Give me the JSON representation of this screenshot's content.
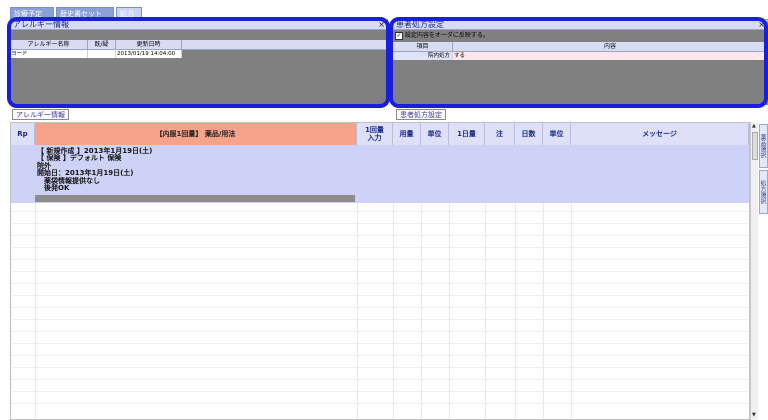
{
  "tabs": [
    {
      "label": "診療予定"
    },
    {
      "label": "歴史書セット"
    },
    {
      "label": "処方"
    }
  ],
  "allergy_panel": {
    "title": "アレルギー情報",
    "close": "×",
    "columns": [
      "アレルギー名称",
      "既/疑",
      "更新日時"
    ],
    "rows": [
      {
        "name": "ヨード",
        "type": "",
        "updated": "2013/01/19 14:04:00"
      }
    ],
    "sub_button": "アレルギー情報"
  },
  "prescription_panel": {
    "title": "患者処方設定",
    "close": "×",
    "checkbox_label": "設定内容をオーダに反映する。",
    "columns": [
      "項目",
      "内容"
    ],
    "rows": [
      {
        "item": "院内処方",
        "value": "する"
      }
    ],
    "sub_button": "患者処方設定"
  },
  "grid": {
    "headers": {
      "rp": "Rp",
      "drug": "【内服1回量】 薬品/用法",
      "dose_input": "1回量\n入力",
      "amount": "用量",
      "unit": "単位",
      "daily": "1日量",
      "note": "注",
      "days": "日数",
      "unit2": "単位",
      "message": "メッセージ"
    },
    "entry_lines": [
      "【 新規作成 】2013年1月19日(土)",
      "【 保険 】デフォルト 保険",
      "院外",
      "開始日：2013年1月19日(土)",
      "薬袋情報提供なし",
      "後発OK"
    ]
  },
  "side_tabs": [
    "薬品選択",
    "処方選択"
  ]
}
